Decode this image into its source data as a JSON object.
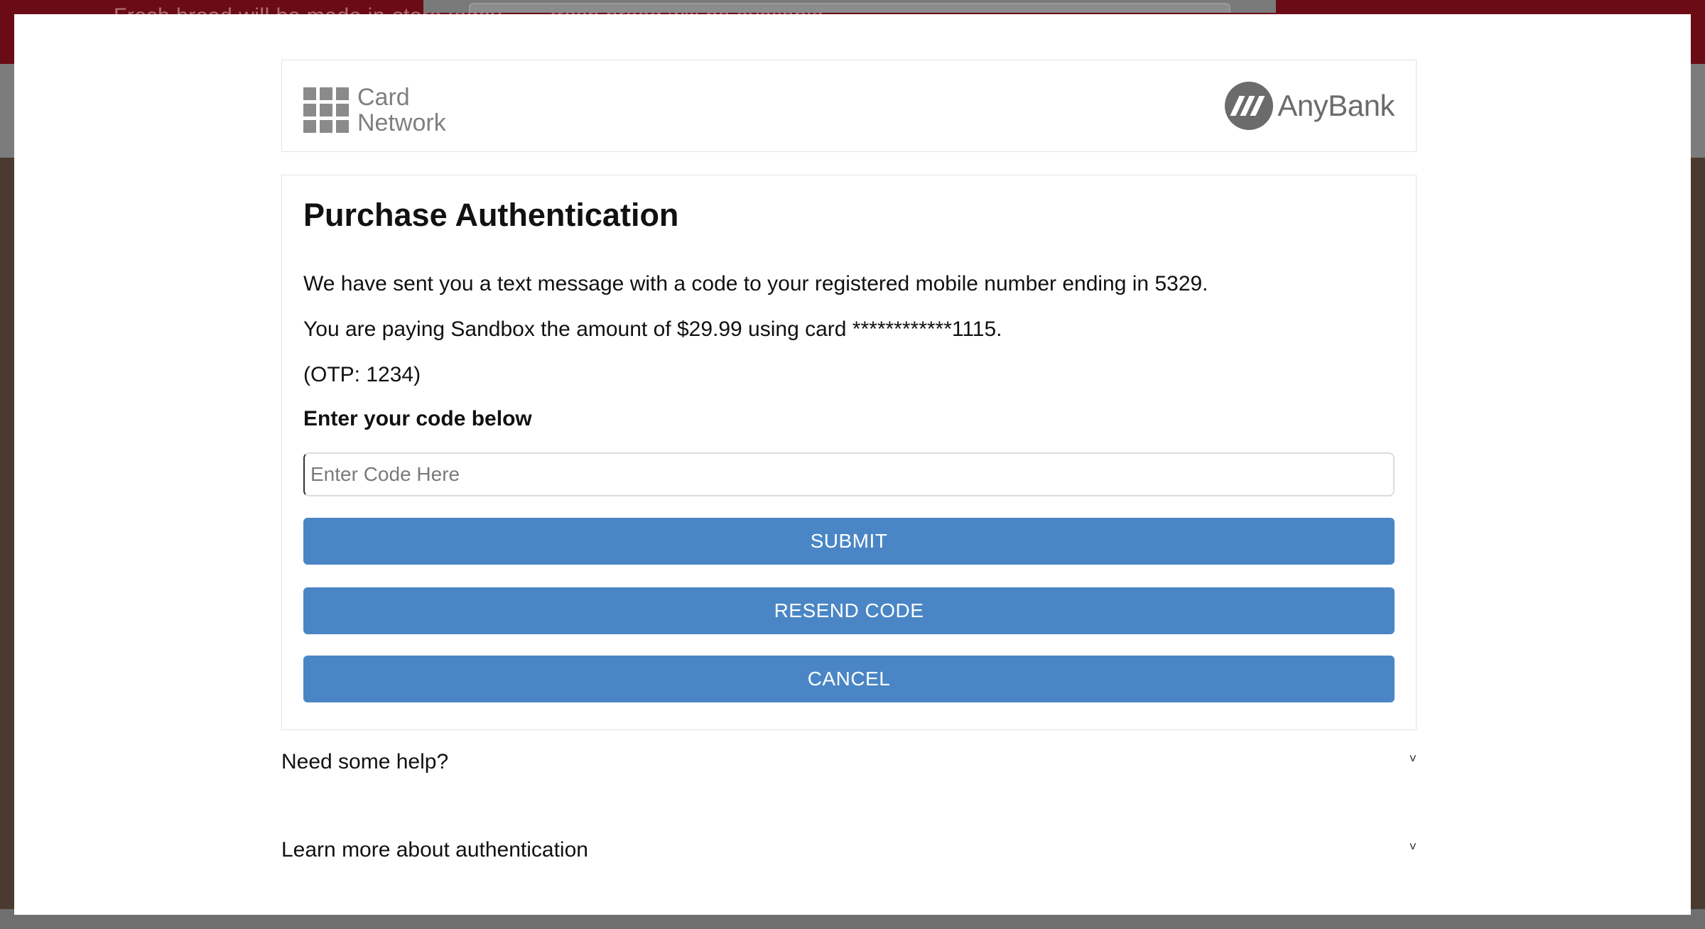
{
  "background": {
    "banner_text": "Fresh bread will be made in-store today... ... fresh bread will be available..."
  },
  "header": {
    "network_logo_line1": "Card",
    "network_logo_line2": "Network",
    "bank_logo_text": "AnyBank"
  },
  "auth": {
    "title": "Purchase Authentication",
    "message_sent": "We have sent you a text message with a code to your registered mobile number ending in 5329.",
    "message_paying": "You are paying Sandbox the amount of $29.99 using card ************1115.",
    "otp_hint": "(OTP: 1234)",
    "code_label": "Enter your code below",
    "code_placeholder": "Enter Code Here",
    "code_value": "",
    "submit_label": "SUBMIT",
    "resend_label": "RESEND CODE",
    "cancel_label": "CANCEL"
  },
  "help": {
    "need_help": "Need some help?",
    "learn_more": "Learn more about authentication",
    "chevron": "˅"
  },
  "colors": {
    "button_bg": "#4a86c5",
    "banner_bg": "#6a0b16"
  }
}
